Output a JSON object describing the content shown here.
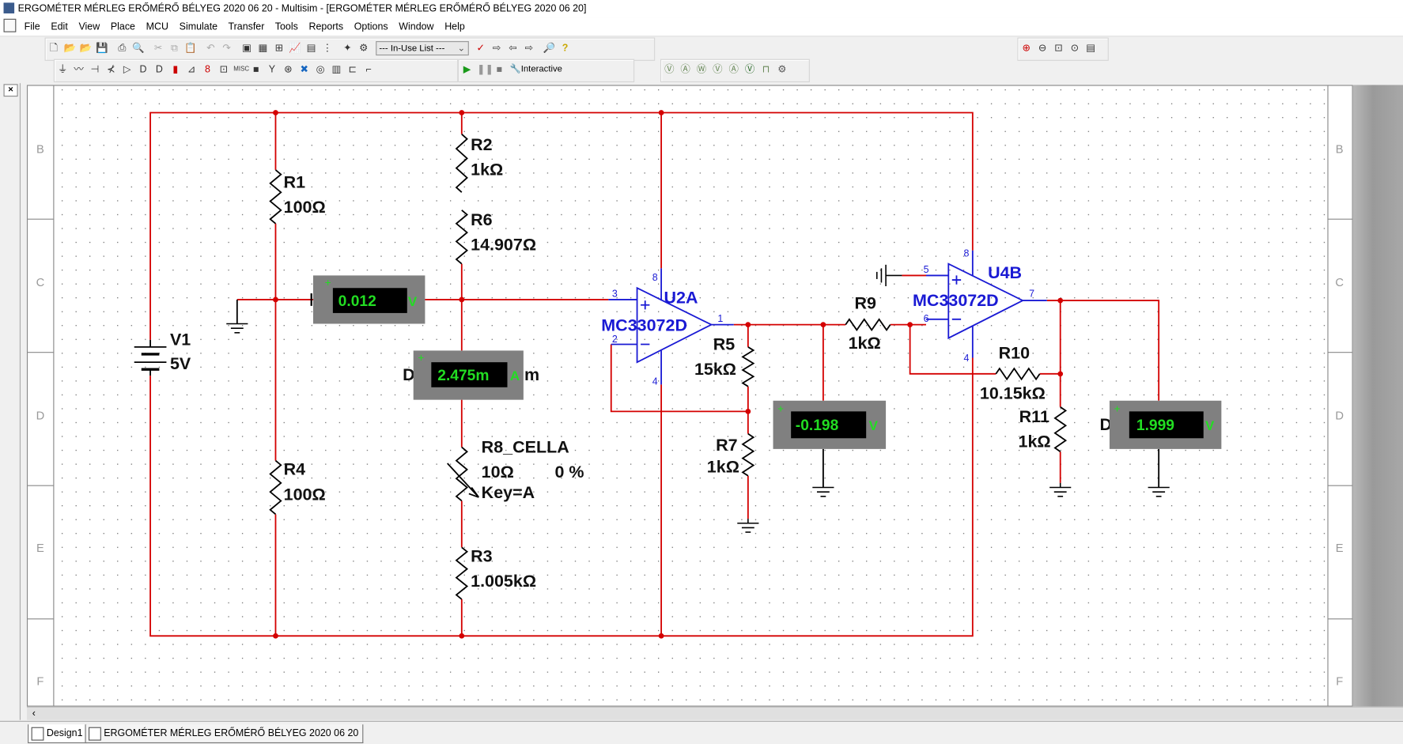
{
  "window": {
    "title": "ERGOMÉTER  MÉRLEG ERŐMÉRŐ BÉLYEG   2020 06 20 - Multisim - [ERGOMÉTER  MÉRLEG ERŐMÉRŐ BÉLYEG   2020 06 20]"
  },
  "menu": [
    "File",
    "Edit",
    "View",
    "Place",
    "MCU",
    "Simulate",
    "Transfer",
    "Tools",
    "Reports",
    "Options",
    "Window",
    "Help"
  ],
  "toolbar": {
    "in_use_list": "--- In-Use List ---",
    "interactive": "Interactive",
    "misc": "MISC"
  },
  "sheet": {
    "row_letters": [
      "B",
      "C",
      "D",
      "E",
      "F"
    ]
  },
  "schematic": {
    "V1": {
      "name": "V1",
      "value": "5V"
    },
    "R1": {
      "name": "R1",
      "value": "100Ω"
    },
    "R2": {
      "name": "R2",
      "value": "1kΩ"
    },
    "R3": {
      "name": "R3",
      "value": "1.005kΩ"
    },
    "R4": {
      "name": "R4",
      "value": "100Ω"
    },
    "R5": {
      "name": "R5",
      "value": "15kΩ"
    },
    "R6": {
      "name": "R6",
      "value": "14.907Ω"
    },
    "R7": {
      "name": "R7",
      "value": "1kΩ"
    },
    "R8": {
      "name": "R8_CELLA",
      "value": "10Ω",
      "percent": "0 %",
      "key": "Key=A"
    },
    "R9": {
      "name": "R9",
      "value": "1kΩ"
    },
    "R10": {
      "name": "R10",
      "value": "10.15kΩ"
    },
    "R11": {
      "name": "R11",
      "value": "1kΩ"
    },
    "U2A": {
      "name": "U2A",
      "part": "MC33072D",
      "pins": [
        "3",
        "2",
        "1",
        "8",
        "4"
      ]
    },
    "U4B": {
      "name": "U4B",
      "part": "MC33072D",
      "pins": [
        "5",
        "6",
        "7",
        "8",
        "4"
      ]
    },
    "meters": [
      {
        "value": "0.012",
        "unit": "V"
      },
      {
        "value": "2.475m",
        "unit": "A",
        "prefix": "D",
        "suffix": "m"
      },
      {
        "value": "-0.198",
        "unit": "V"
      },
      {
        "value": "1.999",
        "unit": "V",
        "prefix": "D"
      }
    ],
    "colors": {
      "wire": "#d40000",
      "part": "#1a1ad4",
      "meter_text": "#22dd22"
    }
  },
  "tabs": [
    "Design1",
    "ERGOMÉTER   MÉRLEG ERŐMÉRŐ BÉLYEG   2020 06 20"
  ]
}
